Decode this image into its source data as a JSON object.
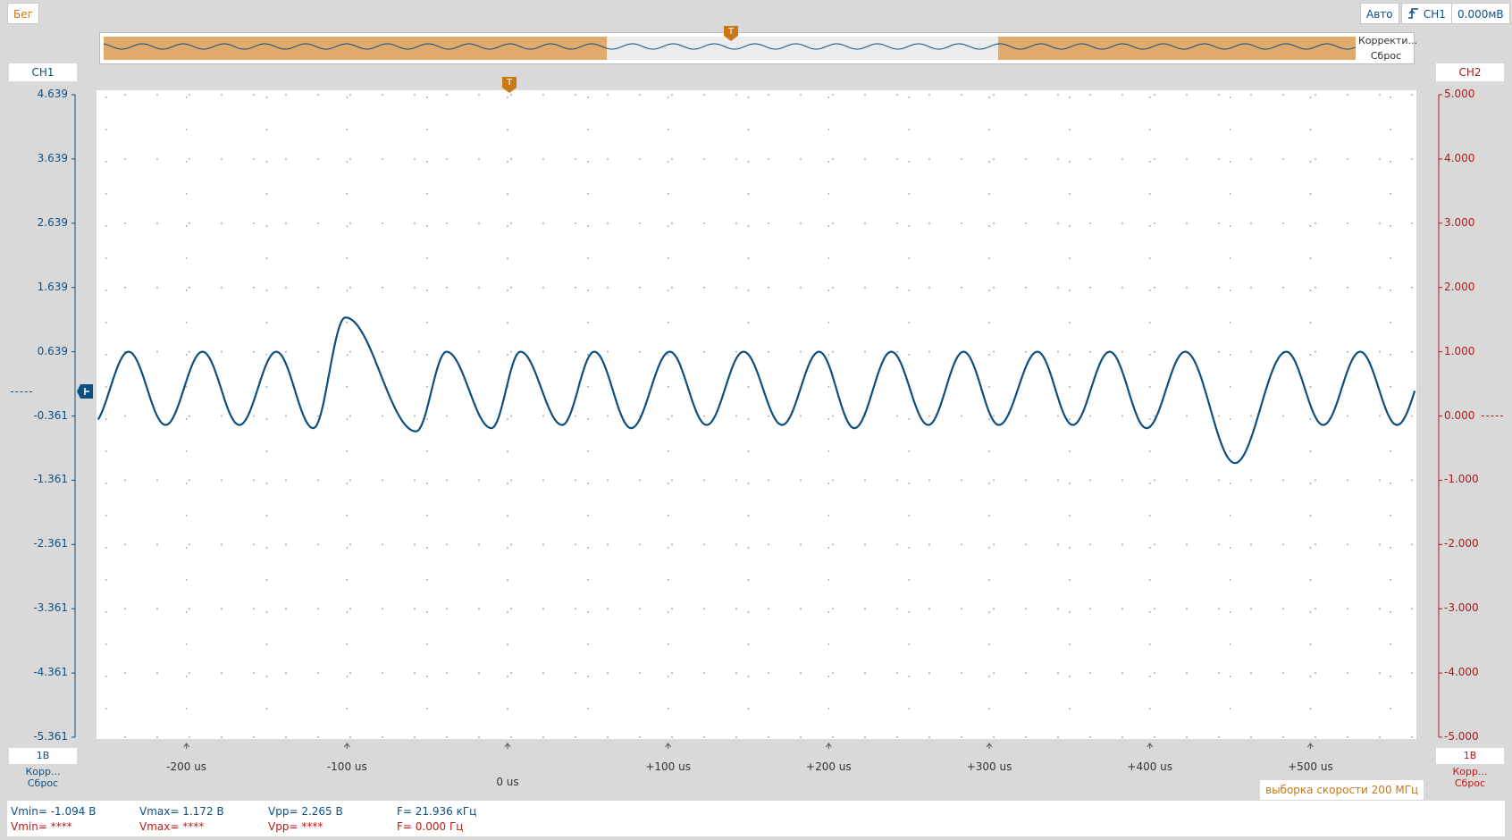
{
  "toolbar": {
    "run_label": "Бег",
    "auto_label": "Авто",
    "trigger_channel": "CH1",
    "trigger_level": "0.000мВ"
  },
  "overview": {
    "correct_label": "Корректи...",
    "reset_label": "Сброс",
    "marker": "T"
  },
  "ch1": {
    "label": "CH1",
    "scale": "1В",
    "correct_label": "Корр...",
    "reset_label": "Сброс",
    "ticks": [
      "4.639",
      "3.639",
      "2.639",
      "1.639",
      "0.639",
      "-0.361",
      "-1.361",
      "-2.361",
      "-3.361",
      "-4.361",
      "-5.361"
    ]
  },
  "ch2": {
    "label": "CH2",
    "scale": "1В",
    "footer": "Корр... Сброс",
    "ticks": [
      "5.000",
      "4.000",
      "3.000",
      "2.000",
      "1.000",
      "0.000",
      "-1.000",
      "-2.000",
      "-3.000",
      "-4.000",
      "-5.000"
    ]
  },
  "plot": {
    "trigger_marker": "T",
    "x_labels": [
      "-200 us",
      "-100 us",
      "0 us",
      "+100 us",
      "+200 us",
      "+300 us",
      "+400 us",
      "+500 us"
    ],
    "sample_rate": "выборка скорости 200 МГц"
  },
  "measurements": {
    "ch1": {
      "vmin": "Vmin= -1.094 В",
      "vmax": "Vmax= 1.172 В",
      "vpp": "Vpp= 2.265 В",
      "freq": "F= 21.936 кГц"
    },
    "ch2": {
      "vmin": "Vmin= ****",
      "vmax": "Vmax= ****",
      "vpp": "Vpp= ****",
      "freq": "F= 0.000 Гц"
    }
  },
  "colors": {
    "ch1": "#0d4f80",
    "ch2": "#c81414",
    "accent": "#c87814",
    "overview_fill": "#e0aa6a"
  },
  "chart_data": {
    "type": "line",
    "title": "",
    "xlabel": "",
    "ylabel": "",
    "x_unit": "us",
    "xlim": [
      -256,
      566
    ],
    "ylim": [
      -5.361,
      4.639
    ],
    "frequency_khz": 21.936,
    "series": [
      {
        "name": "CH1",
        "peaks_us": [
          -236,
          -190,
          -144,
          -101,
          -38,
          8,
          54,
          101,
          147,
          194,
          239,
          284,
          330,
          375,
          422,
          485,
          531
        ],
        "peak_values": [
          0.639,
          0.639,
          0.639,
          1.172,
          0.639,
          0.639,
          0.639,
          0.639,
          0.639,
          0.639,
          0.639,
          0.639,
          0.639,
          0.639,
          0.639,
          0.639,
          0.639
        ],
        "troughs_us": [
          -213,
          -167,
          -121,
          -57,
          -10,
          34,
          77,
          124,
          171,
          216,
          262,
          306,
          352,
          398,
          453,
          508
        ],
        "trough_values": [
          -0.5,
          -0.5,
          -0.55,
          -0.6,
          -0.55,
          -0.5,
          -0.55,
          -0.5,
          -0.5,
          -0.55,
          -0.5,
          -0.5,
          -0.5,
          -0.55,
          -1.094,
          -0.5
        ]
      }
    ]
  }
}
